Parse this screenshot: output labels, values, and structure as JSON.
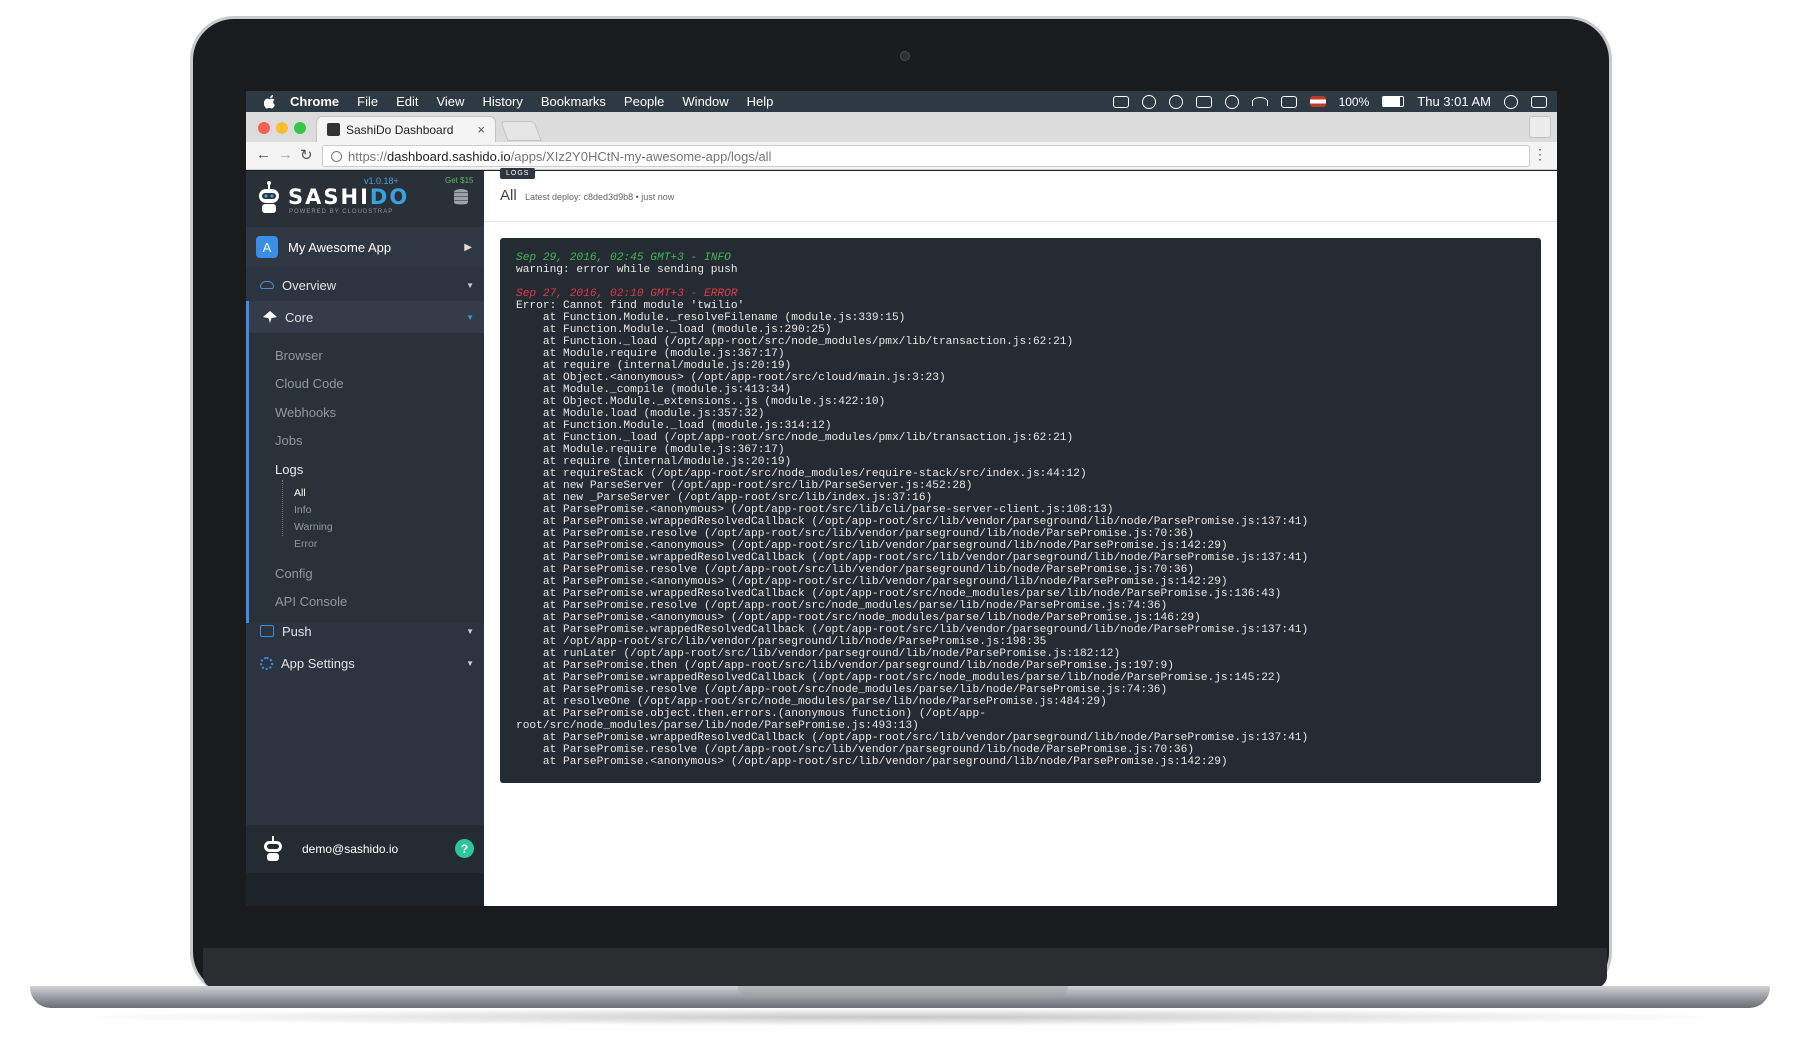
{
  "menubar": {
    "app": "Chrome",
    "items": [
      "File",
      "Edit",
      "View",
      "History",
      "Bookmarks",
      "People",
      "Window",
      "Help"
    ],
    "battery": "100%",
    "clock": "Thu 3:01 AM"
  },
  "browser": {
    "tab_title": "SashiDo Dashboard",
    "tab_close": "×",
    "url_scheme": "https://",
    "url_host": "dashboard.sashido.io",
    "url_path": "/apps/XIz2Y0HCtN-my-awesome-app/logs/all"
  },
  "sidebar": {
    "brand_a": "SASHI",
    "brand_b": "DO",
    "tagline": "POWERED BY CLOUDSTRAP",
    "version": "v1.0.18+",
    "credit": "Get $15",
    "app_name": "My Awesome App",
    "overview": "Overview",
    "core": "Core",
    "core_items": [
      "Browser",
      "Cloud Code",
      "Webhooks",
      "Jobs",
      "Logs",
      "Config",
      "API Console"
    ],
    "log_items": [
      "All",
      "Info",
      "Warning",
      "Error"
    ],
    "push": "Push",
    "app_settings": "App Settings",
    "user_email": "demo@sashido.io",
    "help": "?"
  },
  "main": {
    "breadcrumb": "LOGS",
    "title": "All",
    "deploy_info": "Latest deploy: c8ded3d9b8 • just now",
    "logs": [
      {
        "level": "info",
        "header": "Sep 29, 2016, 02:45 GMT+3 - INFO",
        "lines": [
          "warning: error while sending push"
        ]
      },
      {
        "level": "error",
        "header": "Sep 27, 2016, 02:10 GMT+3 - ERROR",
        "lines": [
          "Error: Cannot find module 'twilio'",
          "    at Function.Module._resolveFilename (module.js:339:15)",
          "    at Function.Module._load (module.js:290:25)",
          "    at Function._load (/opt/app-root/src/node_modules/pmx/lib/transaction.js:62:21)",
          "    at Module.require (module.js:367:17)",
          "    at require (internal/module.js:20:19)",
          "    at Object.<anonymous> (/opt/app-root/src/cloud/main.js:3:23)",
          "    at Module._compile (module.js:413:34)",
          "    at Object.Module._extensions..js (module.js:422:10)",
          "    at Module.load (module.js:357:32)",
          "    at Function.Module._load (module.js:314:12)",
          "    at Function._load (/opt/app-root/src/node_modules/pmx/lib/transaction.js:62:21)",
          "    at Module.require (module.js:367:17)",
          "    at require (internal/module.js:20:19)",
          "    at requireStack (/opt/app-root/src/node_modules/require-stack/src/index.js:44:12)",
          "    at new ParseServer (/opt/app-root/src/lib/ParseServer.js:452:28)",
          "    at new _ParseServer (/opt/app-root/src/lib/index.js:37:16)",
          "    at ParsePromise.<anonymous> (/opt/app-root/src/lib/cli/parse-server-client.js:108:13)",
          "    at ParsePromise.wrappedResolvedCallback (/opt/app-root/src/lib/vendor/parseground/lib/node/ParsePromise.js:137:41)",
          "    at ParsePromise.resolve (/opt/app-root/src/lib/vendor/parseground/lib/node/ParsePromise.js:70:36)",
          "    at ParsePromise.<anonymous> (/opt/app-root/src/lib/vendor/parseground/lib/node/ParsePromise.js:142:29)",
          "    at ParsePromise.wrappedResolvedCallback (/opt/app-root/src/lib/vendor/parseground/lib/node/ParsePromise.js:137:41)",
          "    at ParsePromise.resolve (/opt/app-root/src/lib/vendor/parseground/lib/node/ParsePromise.js:70:36)",
          "    at ParsePromise.<anonymous> (/opt/app-root/src/lib/vendor/parseground/lib/node/ParsePromise.js:142:29)",
          "    at ParsePromise.wrappedResolvedCallback (/opt/app-root/src/node_modules/parse/lib/node/ParsePromise.js:136:43)",
          "    at ParsePromise.resolve (/opt/app-root/src/node_modules/parse/lib/node/ParsePromise.js:74:36)",
          "    at ParsePromise.<anonymous> (/opt/app-root/src/node_modules/parse/lib/node/ParsePromise.js:146:29)",
          "    at ParsePromise.wrappedResolvedCallback (/opt/app-root/src/lib/vendor/parseground/lib/node/ParsePromise.js:137:41)",
          "    at /opt/app-root/src/lib/vendor/parseground/lib/node/ParsePromise.js:198:35",
          "    at runLater (/opt/app-root/src/lib/vendor/parseground/lib/node/ParsePromise.js:182:12)",
          "    at ParsePromise.then (/opt/app-root/src/lib/vendor/parseground/lib/node/ParsePromise.js:197:9)",
          "    at ParsePromise.wrappedResolvedCallback (/opt/app-root/src/node_modules/parse/lib/node/ParsePromise.js:145:22)",
          "    at ParsePromise.resolve (/opt/app-root/src/node_modules/parse/lib/node/ParsePromise.js:74:36)",
          "    at resolveOne (/opt/app-root/src/node_modules/parse/lib/node/ParsePromise.js:484:29)",
          "    at ParsePromise.object.then.errors.(anonymous function) (/opt/app-",
          "root/src/node_modules/parse/lib/node/ParsePromise.js:493:13)",
          "    at ParsePromise.wrappedResolvedCallback (/opt/app-root/src/lib/vendor/parseground/lib/node/ParsePromise.js:137:41)",
          "    at ParsePromise.resolve (/opt/app-root/src/lib/vendor/parseground/lib/node/ParsePromise.js:70:36)",
          "    at ParsePromise.<anonymous> (/opt/app-root/src/lib/vendor/parseground/lib/node/ParsePromise.js:142:29)"
        ]
      }
    ]
  }
}
